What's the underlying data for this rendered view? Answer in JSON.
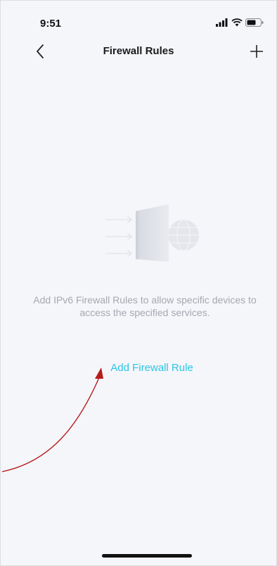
{
  "status_bar": {
    "time": "9:51",
    "icons": [
      "signal-icon",
      "wifi-icon",
      "battery-icon"
    ]
  },
  "nav": {
    "title": "Firewall Rules",
    "back_icon": "chevron-left-icon",
    "add_icon": "plus-icon"
  },
  "empty_state": {
    "illustration": "firewall-globe-illustration",
    "message": "Add IPv6 Firewall Rules to allow specific devices to access the specified services.",
    "action_label": "Add Firewall Rule"
  },
  "colors": {
    "background": "#f5f6fa",
    "accent": "#2ac5e3",
    "muted_text": "#a6a8b0",
    "annotation_arrow": "#b51c1c"
  }
}
